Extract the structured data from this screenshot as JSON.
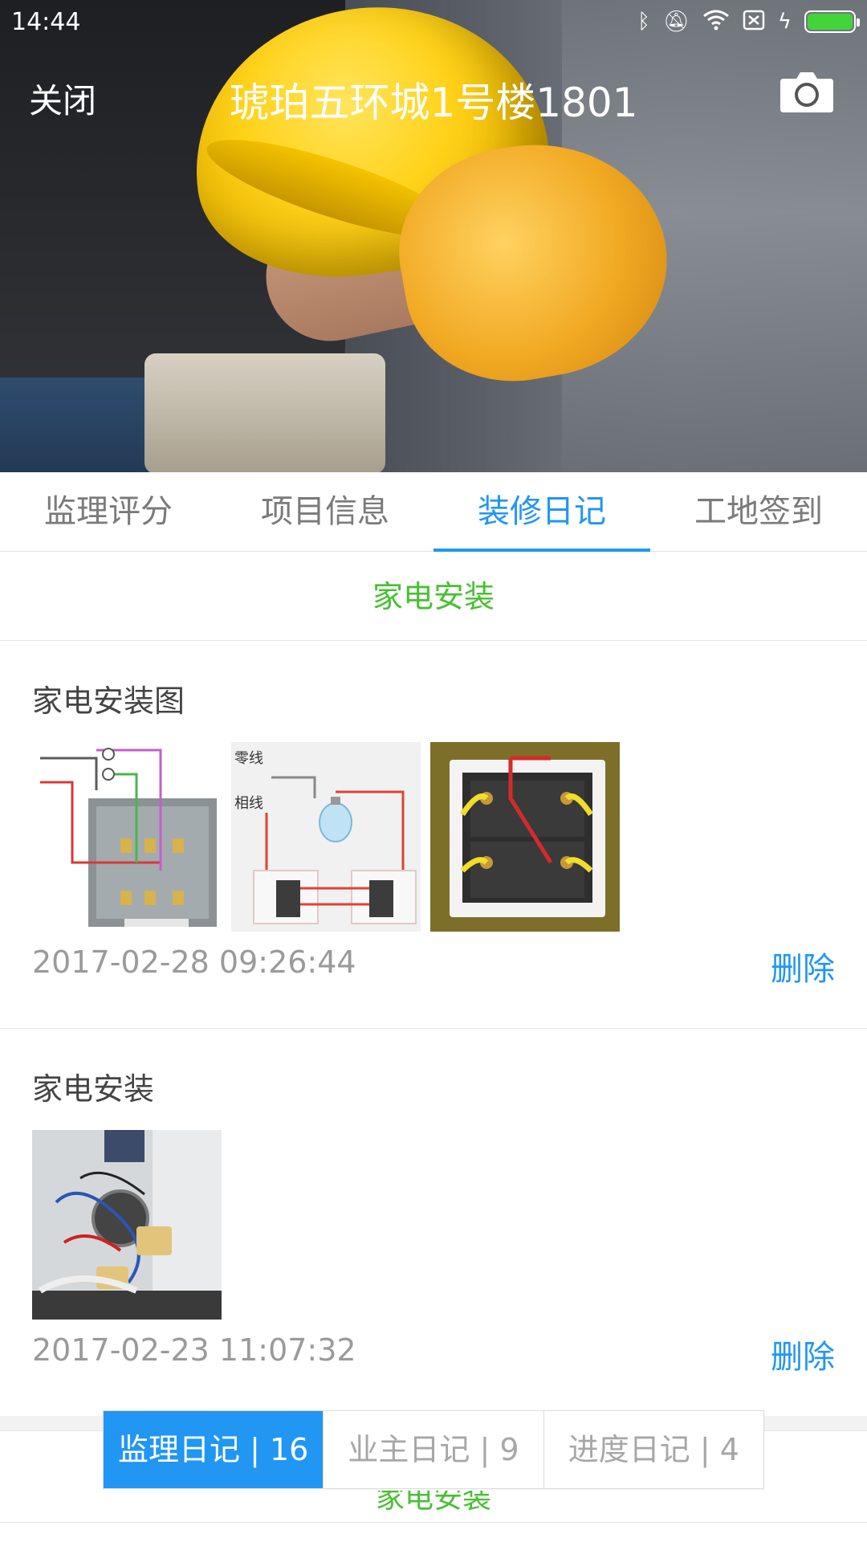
{
  "status_bar": {
    "time": "14:44",
    "icons": [
      "bluetooth-icon",
      "mute-icon",
      "wifi-icon",
      "sim-off-icon",
      "charging-icon",
      "battery-icon"
    ]
  },
  "nav": {
    "close_label": "关闭",
    "title": "琥珀五环城1号楼1801",
    "camera_icon": "camera-icon"
  },
  "tabs": [
    {
      "label": "监理评分",
      "active": false
    },
    {
      "label": "项目信息",
      "active": false
    },
    {
      "label": "装修日记",
      "active": true
    },
    {
      "label": "工地签到",
      "active": false
    }
  ],
  "section_title": "家电安装",
  "entries": [
    {
      "title": "家电安装图",
      "photo_count": 3,
      "time": "2017-02-28 09:26:44",
      "delete_label": "删除",
      "photo_captions": {
        "neutral": "零线",
        "live": "相线"
      }
    },
    {
      "title": "家电安装",
      "photo_count": 1,
      "time": "2017-02-23 11:07:32",
      "delete_label": "删除"
    }
  ],
  "segmented": [
    {
      "label": "监理日记 | 16",
      "active": true
    },
    {
      "label": "业主日记 | 9",
      "active": false
    },
    {
      "label": "进度日记 | 4",
      "active": false
    }
  ],
  "peek_title": "家电安装",
  "colors": {
    "accent": "#2196f3",
    "green": "#48c032",
    "helmet": "#ffd21a"
  }
}
